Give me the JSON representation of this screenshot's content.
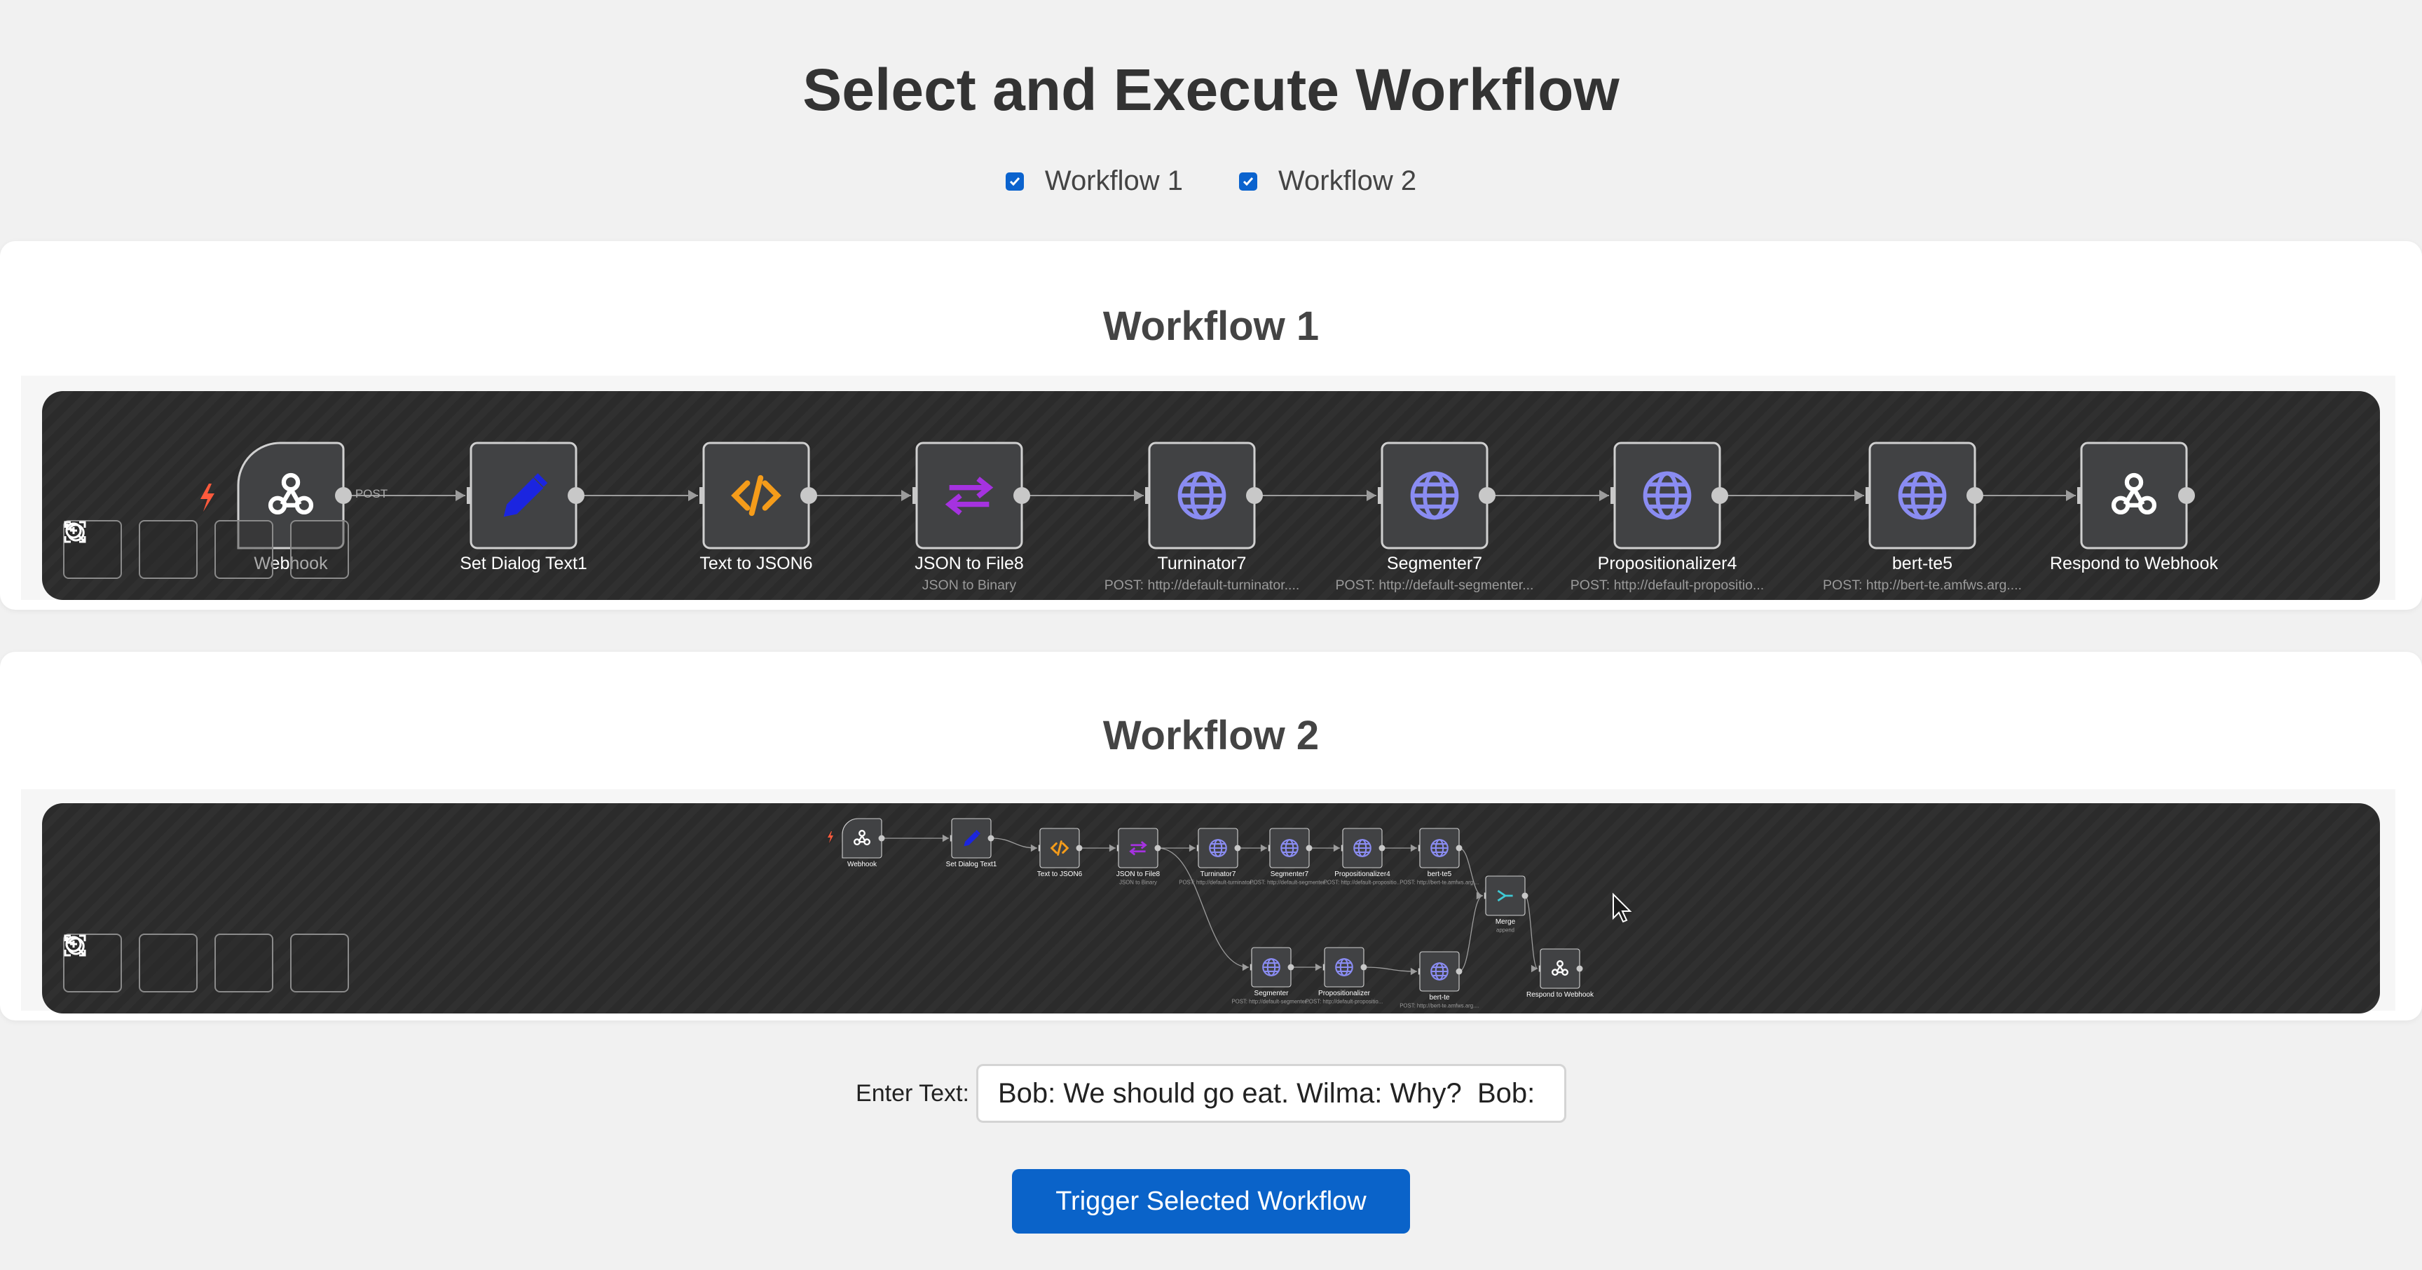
{
  "page": {
    "title": "Select and Execute Workflow",
    "accent_color": "#0a63c9"
  },
  "workflow_select": [
    {
      "label": "Workflow 1",
      "checked": true
    },
    {
      "label": "Workflow 2",
      "checked": true
    }
  ],
  "workflows": [
    {
      "title": "Workflow 1",
      "nodes": [
        {
          "label": "Webhook",
          "sub": "",
          "icon": "webhook-icon",
          "trigger": true
        },
        {
          "label": "Set Dialog Text1",
          "sub": "",
          "icon": "pencil-icon"
        },
        {
          "label": "Text to JSON6",
          "sub": "",
          "icon": "code-icon"
        },
        {
          "label": "JSON to File8",
          "sub": "JSON to Binary",
          "icon": "convert-icon"
        },
        {
          "label": "Turninator7",
          "sub": "POST: http://default-turninator....",
          "icon": "globe-icon"
        },
        {
          "label": "Segmenter7",
          "sub": "POST: http://default-segmenter...",
          "icon": "globe-icon"
        },
        {
          "label": "Propositionalizer4",
          "sub": "POST: http://default-propositio...",
          "icon": "globe-icon"
        },
        {
          "label": "bert-te5",
          "sub": "POST: http://bert-te.amfws.arg....",
          "icon": "globe-icon"
        },
        {
          "label": "Respond to Webhook",
          "sub": "",
          "icon": "webhook-icon"
        }
      ],
      "edge_label": "POST"
    },
    {
      "title": "Workflow 2",
      "nodes": [
        {
          "label": "Webhook",
          "sub": "",
          "icon": "webhook-icon"
        },
        {
          "label": "Set Dialog Text1",
          "sub": "",
          "icon": "pencil-icon"
        },
        {
          "label": "Text to JSON6",
          "sub": "",
          "icon": "code-icon"
        },
        {
          "label": "JSON to File8",
          "sub": "JSON to Binary",
          "icon": "convert-icon"
        },
        {
          "label": "Turninator7",
          "sub": "POST: http://default-turninator....",
          "icon": "globe-icon"
        },
        {
          "label": "Segmenter7",
          "sub": "POST: http://default-segmenter...",
          "icon": "globe-icon"
        },
        {
          "label": "Propositionalizer4",
          "sub": "POST: http://default-propositio...",
          "icon": "globe-icon"
        },
        {
          "label": "bert-te5",
          "sub": "POST: http://bert-te.amfws.arg....",
          "icon": "globe-icon"
        },
        {
          "label": "Merge",
          "sub": "append",
          "icon": "merge-icon"
        },
        {
          "label": "Respond to Webhook",
          "sub": "",
          "icon": "webhook-icon"
        },
        {
          "label": "Segmenter",
          "sub": "POST: http://default-segmenter...",
          "icon": "globe-icon"
        },
        {
          "label": "Propositionalizer",
          "sub": "POST: http://default-propositio...",
          "icon": "globe-icon"
        },
        {
          "label": "bert-te",
          "sub": "POST: http://bert-te.amfws.arg....",
          "icon": "globe-icon"
        }
      ]
    }
  ],
  "controls": [
    "fit-view-icon",
    "zoom-in-icon",
    "zoom-out-icon",
    "reset-zoom-icon"
  ],
  "input": {
    "label": "Enter Text:",
    "value": "Bob: We should go eat. Wilma: Why?  Bob: Be"
  },
  "trigger_button": "Trigger Selected Workflow"
}
